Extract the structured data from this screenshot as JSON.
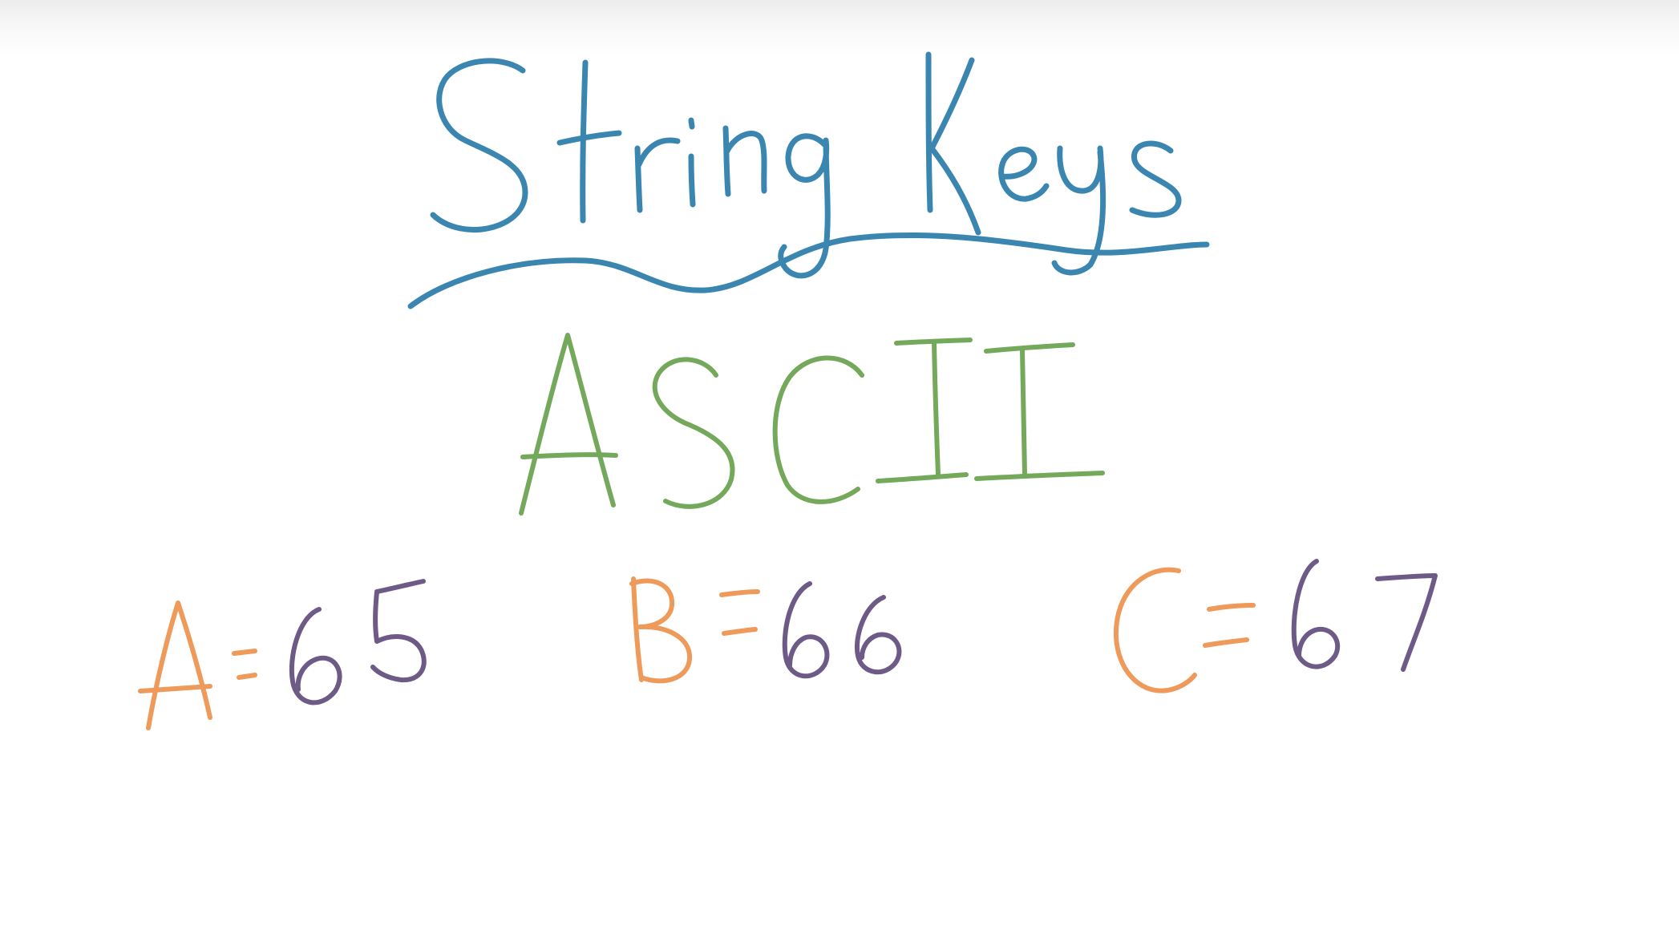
{
  "title": "String Keys",
  "subtitle": "ASCII",
  "mappings": [
    {
      "letter": "A",
      "equals": "=",
      "code": "65"
    },
    {
      "letter": "B",
      "equals": "=",
      "code": "66"
    },
    {
      "letter": "C",
      "equals": "=",
      "code": "67"
    }
  ],
  "colors": {
    "title": "#3a86b0",
    "subtitle": "#74a85a",
    "letter": "#ee9a5b",
    "code": "#6e5a86"
  }
}
